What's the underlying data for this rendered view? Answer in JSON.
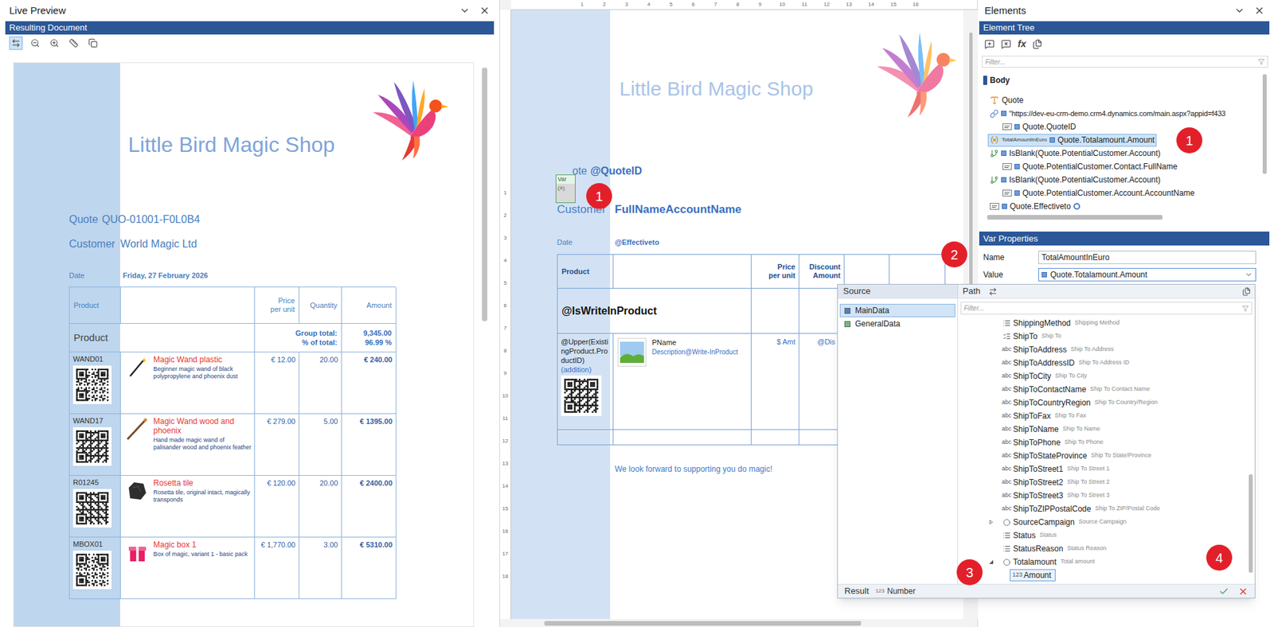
{
  "live_preview": {
    "title": "Live Preview",
    "bar": "Resulting Document",
    "toolbar": [
      {
        "selected": true
      },
      {
        "selected": false
      },
      {
        "selected": false
      },
      {
        "selected": false
      },
      {
        "selected": false
      }
    ],
    "document": {
      "shop_name": "Little Bird Magic Shop",
      "quote_label": "Quote",
      "quote_id": "QUO-01001-F0L0B4",
      "customer_label": "Customer",
      "customer": "World Magic Ltd",
      "date_label": "Date",
      "date": "Friday, 27 February 2026",
      "columns": [
        {
          "lines": [
            "Product"
          ]
        },
        {
          "lines": []
        },
        {
          "lines": [
            "Price",
            "per unit"
          ]
        },
        {
          "lines": [
            "Quantity"
          ]
        },
        {
          "lines": [
            "Amount"
          ]
        }
      ],
      "group": {
        "name": "Product",
        "total_label": "Group total:",
        "total": "9,345.00",
        "share_label": "% of total:",
        "share": "96.99 %"
      },
      "rows": [
        {
          "code": "WAND01",
          "name": "Magic Wand plastic",
          "description": "Beginner magic wand of black polypropylene and phoenix dust",
          "price": "€ 12.00",
          "quantity": "20.00",
          "amount": "€ 240.00"
        },
        {
          "code": "WAND17",
          "name": "Magic Wand wood and phoenix",
          "description": "Hand made magic wand of palisander wood and phoenix feather",
          "price": "€ 279.00",
          "quantity": "5.00",
          "amount": "€ 1395.00"
        },
        {
          "code": "R01245",
          "name": "Rosetta tile",
          "description": "Rosetta tile, original intact, magically transponds",
          "price": "€ 120.00",
          "quantity": "20.00",
          "amount": "€ 2400.00"
        },
        {
          "code": "MBOX01",
          "name": "Magic box 1",
          "description": "Box of magic, variant 1 - basic pack",
          "price": "€ 1,770.00",
          "quantity": "3.00",
          "amount": "€ 5310.00"
        }
      ]
    }
  },
  "designer": {
    "ruler_h": [
      "1",
      "2",
      "3",
      "4",
      "5",
      "6",
      "7",
      "8",
      "9",
      "10",
      "11",
      "12",
      "13",
      "14",
      "15",
      "16"
    ],
    "ruler_v": [
      "1",
      "2",
      "3",
      "4",
      "5",
      "6",
      "7",
      "8",
      "9",
      "10",
      "11",
      "12",
      "13",
      "14",
      "15",
      "16",
      "17",
      "18"
    ],
    "shop_name": "Little Bird Magic Shop",
    "var_marker": {
      "label": "Var",
      "symbol": "(X)",
      "badge": "1"
    },
    "quote_label": "ote",
    "quote_field": "@QuoteID",
    "customer_label": "Customer",
    "customer_field": "FullNameAccountName",
    "date_label": "Date",
    "date_field": "@Effectiveto",
    "table": {
      "badge": "2",
      "columns": [
        {
          "lines": [
            "Product"
          ]
        },
        {
          "lines": []
        },
        {
          "lines": [
            "Price",
            "per unit"
          ]
        },
        {
          "lines": [
            "Discount",
            "Amount"
          ]
        },
        {
          "lines": []
        },
        {
          "lines": []
        }
      ],
      "group_field": "@IsWriteInProduct",
      "row": {
        "product_id": "@Upper(ExistingProduct.ProductID)",
        "note": "(addition)",
        "name": "PName",
        "description": "Description@Write-InProduct",
        "price": "$ Amt",
        "discount": "@Dis"
      }
    },
    "closing": "We look forward to supporting you do magic!"
  },
  "path_picker": {
    "source_header": "Source",
    "path_header": "Path",
    "sources": [
      {
        "name": "MainData",
        "selected": true,
        "color": "#4f7fc4"
      },
      {
        "name": "GeneralData",
        "selected": false,
        "color": "#6cc070"
      }
    ],
    "filter_placeholder": "Filter...",
    "items": [
      {
        "name": "ShippingMethod",
        "label": "Shipping Method",
        "kind": "option",
        "type": "",
        "depth": 0,
        "expander": "none",
        "selected": false
      },
      {
        "name": "ShipTo",
        "label": "Ship To",
        "kind": "bool",
        "type": "",
        "depth": 0,
        "expander": "none",
        "selected": false
      },
      {
        "name": "ShipToAddress",
        "label": "Ship To Address",
        "kind": "text",
        "type": "abc",
        "depth": 0,
        "expander": "none",
        "selected": false
      },
      {
        "name": "ShipToAddressID",
        "label": "Ship To Address ID",
        "kind": "text",
        "type": "abc",
        "depth": 0,
        "expander": "none",
        "selected": false
      },
      {
        "name": "ShipToCity",
        "label": "Ship To City",
        "kind": "text",
        "type": "abc",
        "depth": 0,
        "expander": "none",
        "selected": false
      },
      {
        "name": "ShipToContactName",
        "label": "Ship To Contact Name",
        "kind": "text",
        "type": "abc",
        "depth": 0,
        "expander": "none",
        "selected": false
      },
      {
        "name": "ShipToCountryRegion",
        "label": "Ship To Country/Region",
        "kind": "text",
        "type": "abc",
        "depth": 0,
        "expander": "none",
        "selected": false
      },
      {
        "name": "ShipToFax",
        "label": "Ship To Fax",
        "kind": "text",
        "type": "abc",
        "depth": 0,
        "expander": "none",
        "selected": false
      },
      {
        "name": "ShipToName",
        "label": "Ship To Name",
        "kind": "text",
        "type": "abc",
        "depth": 0,
        "expander": "none",
        "selected": false
      },
      {
        "name": "ShipToPhone",
        "label": "Ship To Phone",
        "kind": "text",
        "type": "abc",
        "depth": 0,
        "expander": "none",
        "selected": false
      },
      {
        "name": "ShipToStateProvince",
        "label": "Ship To State/Province",
        "kind": "text",
        "type": "abc",
        "depth": 0,
        "expander": "none",
        "selected": false
      },
      {
        "name": "ShipToStreet1",
        "label": "Ship To Street 1",
        "kind": "text",
        "type": "abc",
        "depth": 0,
        "expander": "none",
        "selected": false
      },
      {
        "name": "ShipToStreet2",
        "label": "Ship To Street 2",
        "kind": "text",
        "type": "abc",
        "depth": 0,
        "expander": "none",
        "selected": false
      },
      {
        "name": "ShipToStreet3",
        "label": "Ship To Street 3",
        "kind": "text",
        "type": "abc",
        "depth": 0,
        "expander": "none",
        "selected": false
      },
      {
        "name": "ShipToZIPPostalCode",
        "label": "Ship To ZIP/Postal Code",
        "kind": "text",
        "type": "abc",
        "depth": 0,
        "expander": "none",
        "selected": false
      },
      {
        "name": "SourceCampaign",
        "label": "Source Campaign",
        "kind": "lookup",
        "type": "",
        "depth": 0,
        "expander": "collapsed",
        "selected": false
      },
      {
        "name": "Status",
        "label": "Status",
        "kind": "option",
        "type": "",
        "depth": 0,
        "expander": "none",
        "selected": false
      },
      {
        "name": "StatusReason",
        "label": "Status Reason",
        "kind": "option",
        "type": "",
        "depth": 0,
        "expander": "none",
        "selected": false
      },
      {
        "name": "Totalamount",
        "label": "Total amount",
        "kind": "money",
        "type": "",
        "depth": 0,
        "expander": "expanded",
        "selected": false
      },
      {
        "name": "Amount",
        "label": "",
        "kind": "number",
        "type": "123",
        "depth": 1,
        "expander": "none",
        "selected": true
      }
    ],
    "result_label": "Result",
    "result_type_icon": "123",
    "result_type": "Number",
    "tree_badge": "3",
    "confirm_badge": "4"
  },
  "elements": {
    "title": "Elements",
    "bar": "Element Tree",
    "function_glyph": "fx",
    "filter_placeholder": "Filter...",
    "badge": "1",
    "tree": [
      {
        "kind": "document",
        "text": "Body",
        "tag": "",
        "depth": 0,
        "expression": false,
        "selected": false,
        "format_icon": false
      },
      {
        "kind": "text_block",
        "text": "Quote",
        "tag": "",
        "depth": 0,
        "expression": false,
        "selected": false,
        "format_icon": false
      },
      {
        "kind": "link",
        "text": "\"https://dev-eu-crm-demo.crm4.dynamics.com/main.aspx?appid=f433",
        "tag": "",
        "depth": 0,
        "expression": true,
        "selected": false,
        "format_icon": false
      },
      {
        "kind": "field",
        "text": "Quote.QuoteID",
        "tag": "",
        "depth": 1,
        "expression": true,
        "selected": false,
        "format_icon": false
      },
      {
        "kind": "variable",
        "text": "Quote.Totalamount.Amount",
        "tag": "TotalAmountInEuro",
        "depth": 0,
        "expression": true,
        "selected": true,
        "format_icon": false
      },
      {
        "kind": "condition",
        "text": "IsBlank(Quote.PotentialCustomer.Account)",
        "tag": "",
        "depth": 0,
        "expression": true,
        "selected": false,
        "format_icon": false
      },
      {
        "kind": "field",
        "text": "Quote.PotentialCustomer.Contact.FullName",
        "tag": "",
        "depth": 1,
        "expression": true,
        "selected": false,
        "format_icon": false
      },
      {
        "kind": "condition",
        "text": "IsBlank(Quote.PotentialCustomer.Account)",
        "tag": "",
        "depth": 0,
        "expression": true,
        "selected": false,
        "format_icon": false
      },
      {
        "kind": "field",
        "text": "Quote.PotentialCustomer.Account.AccountName",
        "tag": "",
        "depth": 1,
        "expression": true,
        "selected": false,
        "format_icon": false
      },
      {
        "kind": "field",
        "text": "Quote.Effectiveto",
        "tag": "",
        "depth": 0,
        "expression": true,
        "selected": false,
        "format_icon": true
      }
    ],
    "properties": {
      "bar": "Var Properties",
      "fields": [
        {
          "label": "Name",
          "value": "TotalAmountInEuro",
          "kind": "text"
        },
        {
          "label": "Value",
          "value": "Quote.Totalamount.Amount",
          "kind": "dropdown"
        }
      ]
    }
  }
}
